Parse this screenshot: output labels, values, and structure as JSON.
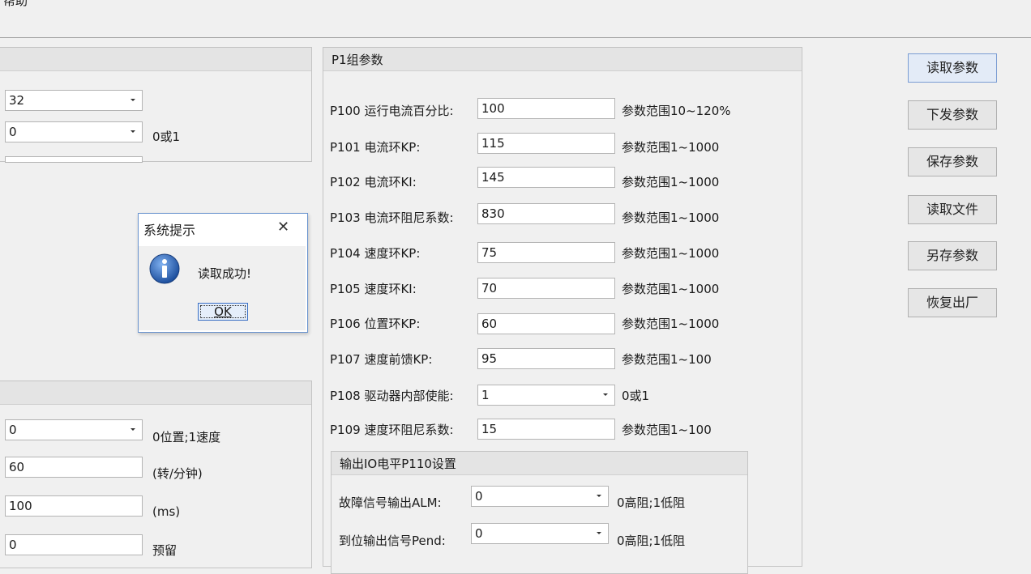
{
  "menu": {
    "help": "帮助"
  },
  "left_panel_top": {
    "field1_value": "32",
    "field2_value": "0",
    "field2_hint": "0或1"
  },
  "left_panel_bottom": {
    "fields": [
      {
        "value": "0",
        "hint": "0位置;1速度"
      },
      {
        "value": "60",
        "hint": "(转/分钟)"
      },
      {
        "value": "100",
        "hint": "(ms)"
      },
      {
        "value": "0",
        "hint": "预留"
      }
    ]
  },
  "p1_panel": {
    "title": "P1组参数",
    "params": [
      {
        "label": "P100 运行电流百分比:",
        "value": "100",
        "range": "参数范围10~120%"
      },
      {
        "label": "P101 电流环KP:",
        "value": "115",
        "range": "参数范围1~1000"
      },
      {
        "label": "P102 电流环KI:",
        "value": "145",
        "range": "参数范围1~1000"
      },
      {
        "label": "P103 电流环阻尼系数:",
        "value": "830",
        "range": "参数范围1~1000"
      },
      {
        "label": "P104 速度环KP:",
        "value": "75",
        "range": "参数范围1~1000"
      },
      {
        "label": "P105 速度环KI:",
        "value": "70",
        "range": "参数范围1~1000"
      },
      {
        "label": "P106 位置环KP:",
        "value": "60",
        "range": "参数范围1~1000"
      },
      {
        "label": "P107 速度前馈KP:",
        "value": "95",
        "range": "参数范围1~100"
      },
      {
        "label": "P108 驱动器内部使能:",
        "value": "1",
        "range": "0或1"
      },
      {
        "label": "P109 速度环阻尼系数:",
        "value": "15",
        "range": "参数范围1~100"
      }
    ],
    "io_group": {
      "title": "输出IO电平P110设置",
      "rows": [
        {
          "label": "故障信号输出ALM:",
          "value": "0",
          "hint": "0高阻;1低阻"
        },
        {
          "label": "到位输出信号Pend:",
          "value": "0",
          "hint": "0高阻;1低阻"
        }
      ]
    }
  },
  "buttons": {
    "read_params": "读取参数",
    "send_params": "下发参数",
    "save_params": "保存参数",
    "read_file": "读取文件",
    "save_as": "另存参数",
    "restore_factory": "恢复出厂"
  },
  "dialog": {
    "title": "系统提示",
    "message": "读取成功!",
    "ok_label": "OK"
  },
  "colors": {
    "accent": "#6a94cf",
    "info_icon": "#2a5fb5"
  }
}
